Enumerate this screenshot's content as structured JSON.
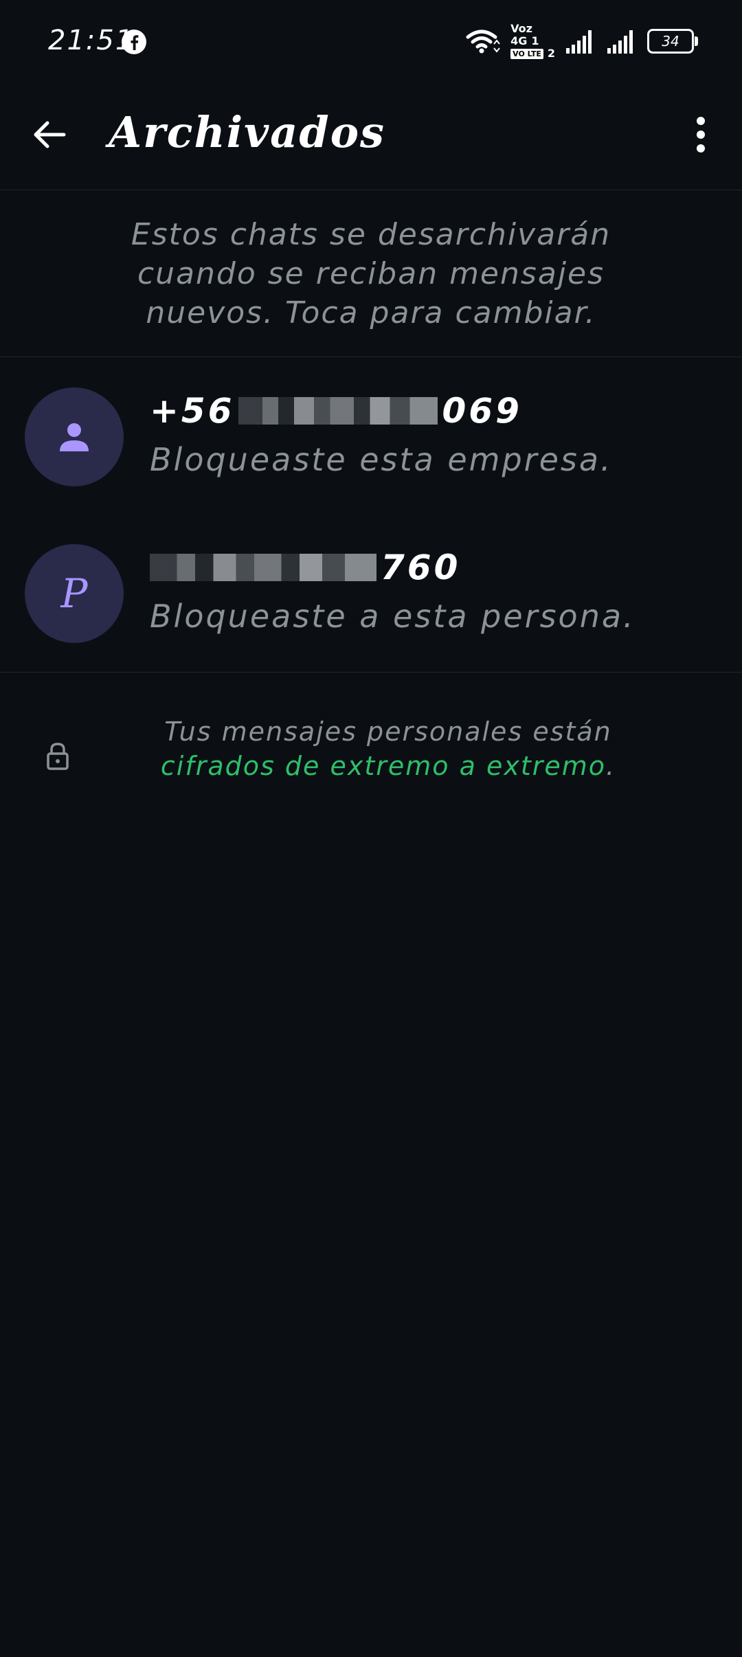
{
  "status_bar": {
    "time": "21:51",
    "network_type": "4G",
    "voz_label": "Voz",
    "sim1": "1",
    "sim2": "2",
    "volte": "VO LTE",
    "battery": "34"
  },
  "header": {
    "title": "Archivados"
  },
  "banner": {
    "text": "Estos chats se desarchivarán cuando se reciban mensajes nuevos. Toca para cambiar."
  },
  "chats": [
    {
      "name_prefix": "+56",
      "name_suffix": "069",
      "preview": "Bloqueaste esta empresa.",
      "avatar_icon": "person-icon"
    },
    {
      "avatar_letter": "P",
      "name_suffix": "760",
      "preview": "Bloqueaste a esta persona."
    }
  ],
  "footer": {
    "text": "Tus mensajes personales están ",
    "link": "cifrados de extremo a extremo",
    "end": "."
  },
  "colors": {
    "background": "#0b0f14",
    "accent_green": "#2fbf6a",
    "avatar_bg": "#2a2a4a",
    "avatar_fg": "#a996ff"
  }
}
